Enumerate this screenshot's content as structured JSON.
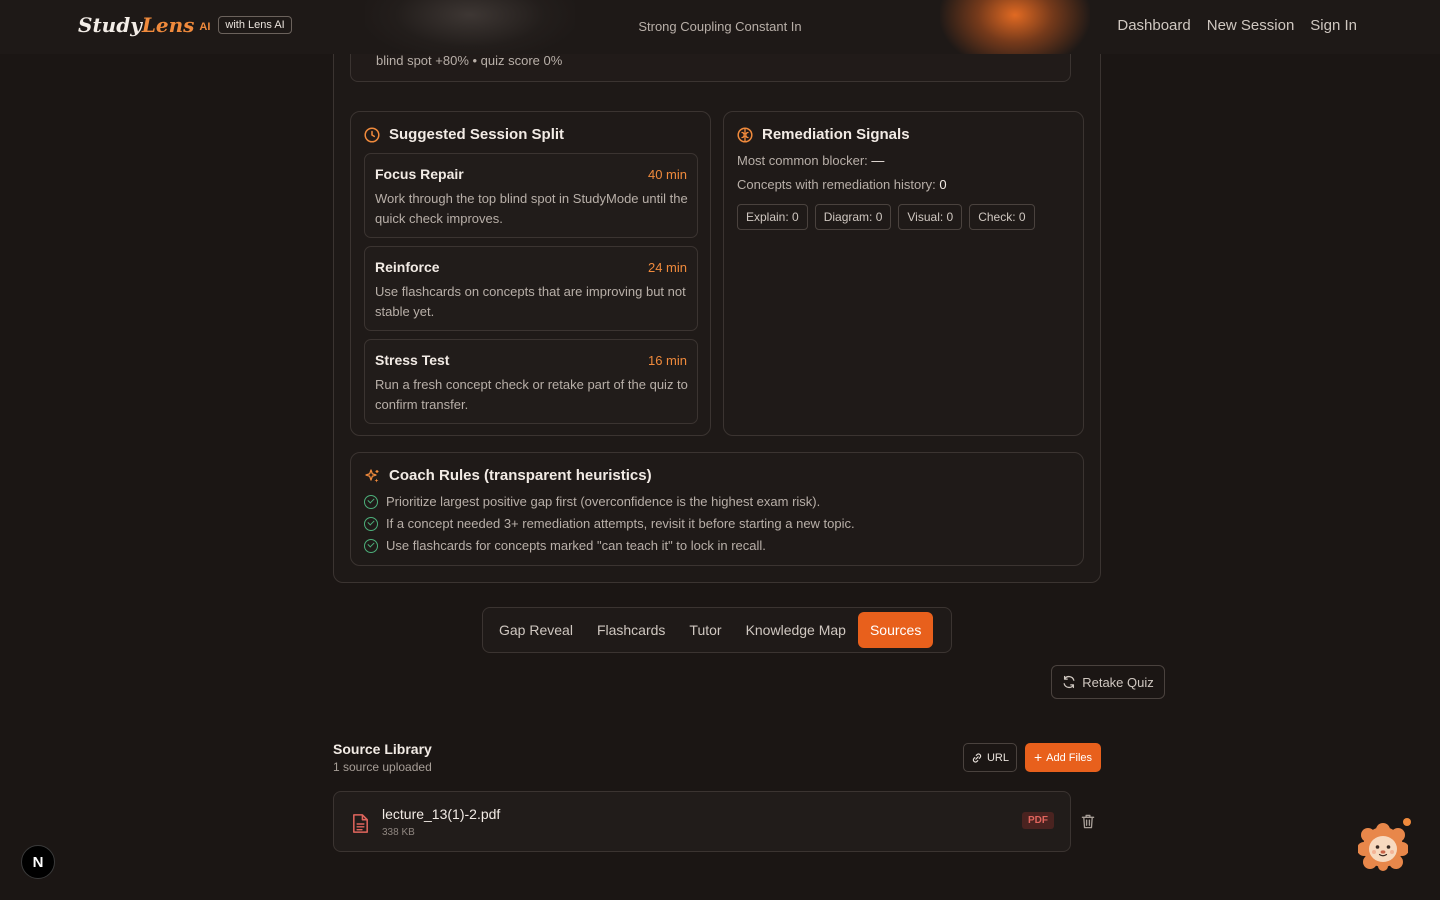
{
  "header": {
    "logo_study": "Study",
    "logo_lens": "Lens",
    "logo_ai": "AI",
    "logo_badge": "with Lens AI",
    "title": "Strong Coupling Constant In",
    "nav": [
      "Dashboard",
      "New Session",
      "Sign In"
    ]
  },
  "top_card": {
    "text": "blind spot +80% • quiz score 0%"
  },
  "session_split": {
    "title": "Suggested Session Split",
    "items": [
      {
        "name": "Focus Repair",
        "minutes": "40 min",
        "desc": "Work through the top blind spot in StudyMode until the quick check improves."
      },
      {
        "name": "Reinforce",
        "minutes": "24 min",
        "desc": "Use flashcards on concepts that are improving but not stable yet."
      },
      {
        "name": "Stress Test",
        "minutes": "16 min",
        "desc": "Run a fresh concept check or retake part of the quiz to confirm transfer."
      }
    ]
  },
  "remediation": {
    "title": "Remediation Signals",
    "blocker_label": "Most common blocker:",
    "blocker_value": "—",
    "history_label": "Concepts with remediation history:",
    "history_value": "0",
    "chips": [
      "Explain: 0",
      "Diagram: 0",
      "Visual: 0",
      "Check: 0"
    ]
  },
  "coach_rules": {
    "title": "Coach Rules (transparent heuristics)",
    "rules": [
      "Prioritize largest positive gap first (overconfidence is the highest exam risk).",
      "If a concept needed 3+ remediation attempts, revisit it before starting a new topic.",
      "Use flashcards for concepts marked \"can teach it\" to lock in recall."
    ]
  },
  "tabs": [
    "Gap Reveal",
    "Flashcards",
    "Tutor",
    "Knowledge Map",
    "Sources"
  ],
  "active_tab": "Sources",
  "retake_label": "Retake Quiz",
  "library": {
    "title": "Source Library",
    "subtitle": "1 source uploaded",
    "url_label": "URL",
    "add_label": "Add Files",
    "files": [
      {
        "name": "lecture_13(1)-2.pdf",
        "size": "338 KB",
        "type": "PDF"
      }
    ]
  },
  "n_badge": "N",
  "colors": {
    "accent": "#e8601c",
    "accent_text": "#f08a3c",
    "background": "#1b1614",
    "success": "#4caf7a",
    "pdf": "#e0655d"
  }
}
